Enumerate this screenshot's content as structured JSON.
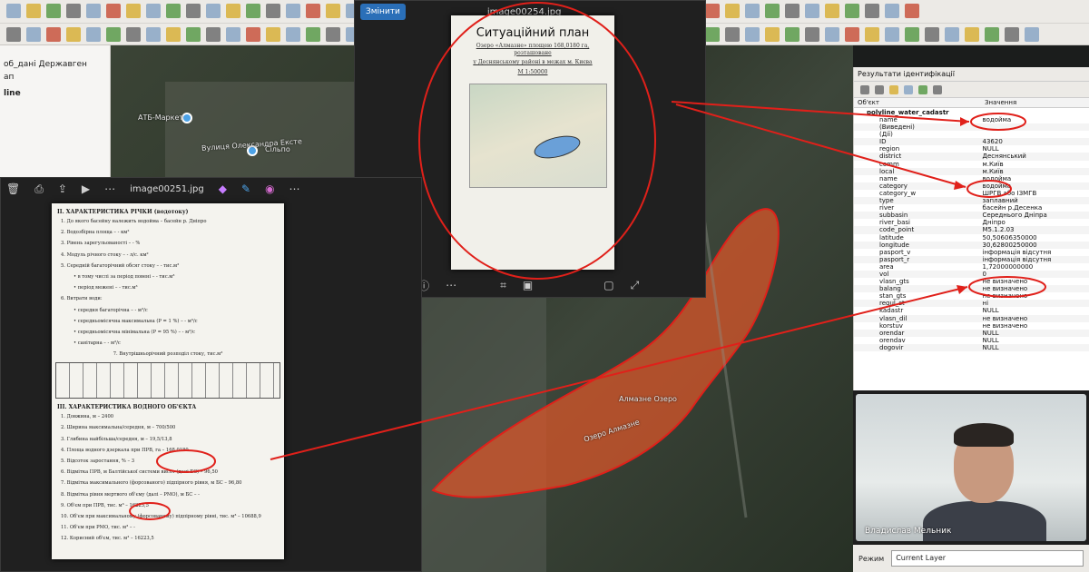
{
  "top_viewer": {
    "edit_button": "Змінити",
    "filename": "image00254.jpg",
    "doc_title": "Ситуаційний план",
    "doc_subtitle_1": "Озеро «Алмазне» площею 168,0180 га, розташоване",
    "doc_subtitle_2": "у Деснянському районі в межах м. Києва",
    "doc_scale": "М 1:50000"
  },
  "left_viewer": {
    "filename": "image00251.jpg",
    "doc": {
      "heading_2": "II. ХАРАКТЕРИСТИКА РІЧКИ (водотоку)",
      "items_2": [
        "1.  До якого басейну належить водойма – басейн р. Дніпро",
        "2.  Водозбірна площа – - км²",
        "3.  Рівень зарегульованості – - %",
        "4.  Модуль річного стоку – - л/с. км²",
        "5.  Середній багаторічний обсяг стоку – - тис.м³",
        "•  в тому числі за період повені – - тис.м³",
        "•  період межені – - тис.м³",
        "6.  Витрати води:",
        "•  середня багаторічна – - м³/с",
        "•  середньомісячна максимальна (P = 1 %) – - м³/с",
        "•  середньомісячна мінімальна (P = 95 %) – - м³/с",
        "•  санітарна – - м³/с"
      ],
      "table_caption": "7.  Внутрішньорічний розподіл стоку, тис.м³",
      "heading_3": "III. ХАРАКТЕРИСТИКА ВОДНОГО ОБ'ЄКТА",
      "items_3": [
        "1.  Довжина, м – 2400",
        "2.  Ширина максимальна/середня, м – 700/500",
        "3.  Глибина найбільша/середня, м – 19,5/13,8",
        "4.  Площа водного дзеркала при ПРВ, га – 168,0180",
        "5.  Відсоток заростання, % – 3",
        "6.  Відмітка ПРВ, м Балтійської системи висот (далі БС) – 96,50",
        "7.  Відмітка максимального (форсованого) підпірного рівня, м БС – 96,80",
        "8.  Відмітка рівня мертвого об'єму (далі – РМО), м БС – -",
        "9.  Об'єм при ПРВ, тис. м³ – 16223,5",
        "10. Об'єм при максимальному (форсованому) підпірному рівні, тис. м³ – 10688,9",
        "11. Об'єм при РМО, тис. м³ – -",
        "12. Корисний об'єм, тис. м³ – 16223,5"
      ]
    }
  },
  "layers_panel": {
    "rows": [
      "об_дані Державген",
      "ап",
      "",
      "line"
    ]
  },
  "map_labels": [
    "АТБ-Маркет",
    "Сільпо",
    "Алмазне Озеро",
    "Озеро Алмазне",
    "Вулиця Олександра Ексте"
  ],
  "ident_panel": {
    "title": "Результати ідентифікації",
    "col_object": "Об'єкт",
    "col_value": "Значення",
    "layer_name": "polyline_water_cadastr",
    "rows": [
      {
        "k": "name",
        "v": "водойма"
      },
      {
        "k": "(Виведені)",
        "v": ""
      },
      {
        "k": "(Дії)",
        "v": ""
      },
      {
        "k": "ID",
        "v": "43620"
      },
      {
        "k": "region",
        "v": "NULL"
      },
      {
        "k": "district",
        "v": "Деснянський"
      },
      {
        "k": "comm",
        "v": "м.Київ"
      },
      {
        "k": "local",
        "v": "м.Київ"
      },
      {
        "k": "name",
        "v": "водойма"
      },
      {
        "k": "category",
        "v": "водойма"
      },
      {
        "k": "category_w",
        "v": "ШРГВ або ІЗМГВ"
      },
      {
        "k": "type",
        "v": "заплавний"
      },
      {
        "k": "river",
        "v": "басейн р.Десенка"
      },
      {
        "k": "subbasin",
        "v": "Середнього Дніпра"
      },
      {
        "k": "river_basi",
        "v": "Дніпро"
      },
      {
        "k": "code_point",
        "v": "M5.1.2.03"
      },
      {
        "k": "latitude",
        "v": "50,50606350000"
      },
      {
        "k": "longitude",
        "v": "30,62800250000"
      },
      {
        "k": "pasport_v",
        "v": "інформація відсутня"
      },
      {
        "k": "pasport_r",
        "v": "інформація відсутня"
      },
      {
        "k": "area",
        "v": "1,72000000000"
      },
      {
        "k": "vol",
        "v": "0"
      },
      {
        "k": "vlasn_gts",
        "v": "не визначено"
      },
      {
        "k": "balang",
        "v": "не визначено"
      },
      {
        "k": "stan_gts",
        "v": "не визначено"
      },
      {
        "k": "regul_st",
        "v": "ні"
      },
      {
        "k": "kadastr",
        "v": "NULL"
      },
      {
        "k": "vlasn_dil",
        "v": "не визначено"
      },
      {
        "k": "korstuv",
        "v": "не визначено"
      },
      {
        "k": "orendar",
        "v": "NULL"
      },
      {
        "k": "orendav",
        "v": "NULL"
      },
      {
        "k": "dogovir",
        "v": "NULL"
      }
    ]
  },
  "webcam": {
    "participant": "Владислав Мельник"
  },
  "mode_bar": {
    "label": "Режим",
    "value": "Current Layer"
  },
  "colors": {
    "annotation_red": "#e0201a",
    "lake_fill": "#d8552a",
    "accent": "#2a6fb8"
  }
}
